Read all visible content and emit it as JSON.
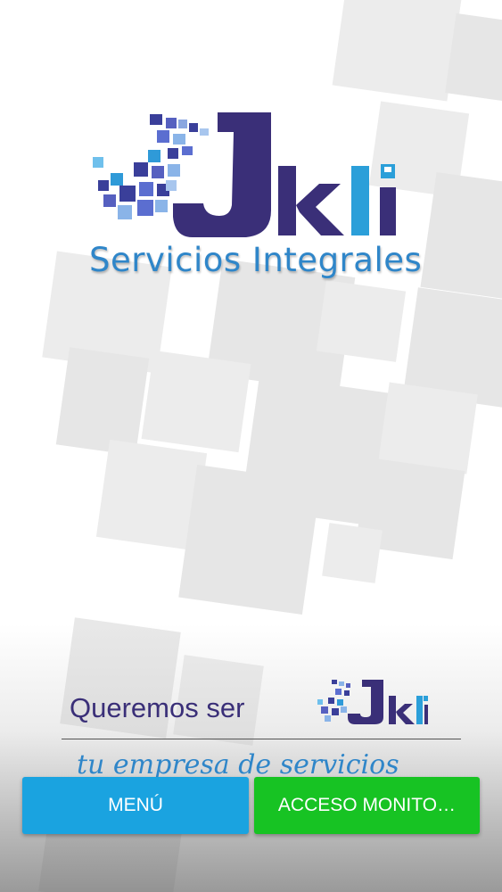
{
  "brand": {
    "logo_text": "Jkli",
    "subtitle": "Servicios Integrales"
  },
  "tagline": {
    "line1": "Queremos ser",
    "line2": "tu empresa de servicios"
  },
  "buttons": {
    "menu_label": "MENÚ",
    "monitor_label": "ACCESO MONITO…"
  },
  "colors": {
    "menu_button": "#1aa3e0",
    "monitor_button": "#17c323",
    "brand_dark": "#3a2f78",
    "brand_blue": "#2f86c9"
  }
}
